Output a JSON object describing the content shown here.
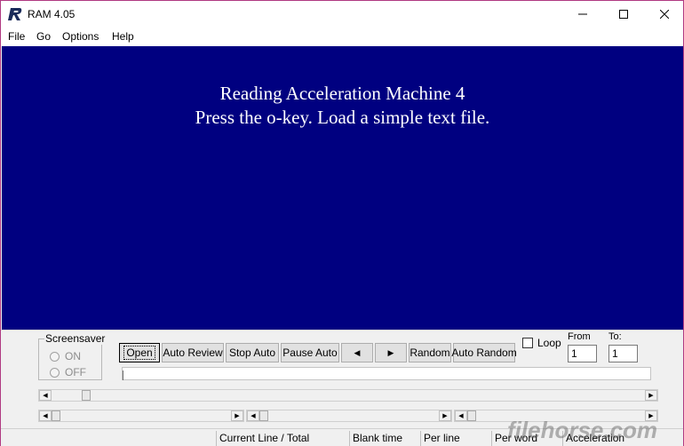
{
  "window": {
    "title": "RAM 4.05"
  },
  "menu": [
    "File",
    "Go",
    "Options",
    "Help"
  ],
  "display": {
    "line1": "Reading Acceleration Machine 4",
    "line2": "Press the o-key. Load a simple text file."
  },
  "screensaver": {
    "title": "Screensaver",
    "on_label": "ON",
    "off_label": "OFF"
  },
  "buttons": {
    "open": "Open",
    "auto_review": "Auto Review",
    "stop_auto": "Stop Auto",
    "pause_auto": "Pause Auto",
    "prev": "◀",
    "next": "▶",
    "random": "Random",
    "auto_random": "Auto Random"
  },
  "loop": {
    "label": "Loop",
    "checked": false
  },
  "range": {
    "from_label": "From",
    "from_value": "1",
    "to_label": "To:",
    "to_value": "1"
  },
  "status": {
    "current_line": "Current Line / Total",
    "blank_time": "Blank time",
    "per_line": "Per line",
    "per_word": "Per word",
    "acceleration": "Acceleration"
  },
  "icons": {
    "app": "ram-logo-icon",
    "minimize": "minimize-icon",
    "maximize": "maximize-icon",
    "close": "close-icon"
  },
  "watermark": "filehorse.com"
}
